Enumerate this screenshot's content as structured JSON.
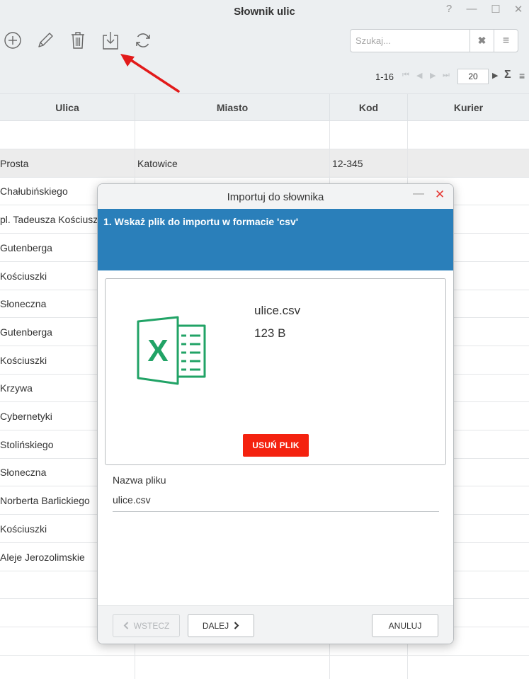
{
  "window": {
    "title": "Słownik ulic",
    "help": "?",
    "minimize": "—",
    "maximize": "☐",
    "close": "✕"
  },
  "toolbar": {
    "icons": [
      "add-icon",
      "edit-icon",
      "trash-icon",
      "import-icon",
      "refresh-icon"
    ]
  },
  "search": {
    "placeholder": "Szukaj...",
    "value": "",
    "clear": "✖",
    "menu": "≡"
  },
  "pager": {
    "range": "1-16",
    "page_size": "20",
    "first": "⏮",
    "prev": "◀",
    "next_disabled": "▶",
    "last": "⏭",
    "next": "▶",
    "sum": "Σ",
    "menu": "≡"
  },
  "grid": {
    "columns": [
      "Ulica",
      "Miasto",
      "Kod",
      "Kurier"
    ],
    "rows": [
      {
        "ulica": "",
        "miasto": "",
        "kod": ""
      },
      {
        "ulica": "Prosta",
        "miasto": "Katowice",
        "kod": "12-345"
      },
      {
        "ulica": "Chałubińskiego",
        "miasto": "",
        "kod": ""
      },
      {
        "ulica": "pl. Tadeusza Kościuszki",
        "miasto": "",
        "kod": ""
      },
      {
        "ulica": "Gutenberga",
        "miasto": "",
        "kod": ""
      },
      {
        "ulica": "Kościuszki",
        "miasto": "",
        "kod": ""
      },
      {
        "ulica": "Słoneczna",
        "miasto": "",
        "kod": ""
      },
      {
        "ulica": "Gutenberga",
        "miasto": "",
        "kod": ""
      },
      {
        "ulica": "Kościuszki",
        "miasto": "",
        "kod": ""
      },
      {
        "ulica": "Krzywa",
        "miasto": "",
        "kod": ""
      },
      {
        "ulica": "Cybernetyki",
        "miasto": "",
        "kod": ""
      },
      {
        "ulica": "Stolińskiego",
        "miasto": "",
        "kod": ""
      },
      {
        "ulica": "Słoneczna",
        "miasto": "",
        "kod": ""
      },
      {
        "ulica": "Norberta Barlickiego",
        "miasto": "",
        "kod": ""
      },
      {
        "ulica": "Kościuszki",
        "miasto": "",
        "kod": ""
      },
      {
        "ulica": "Aleje Jerozolimskie",
        "miasto": "",
        "kod": ""
      },
      {
        "ulica": "",
        "miasto": "",
        "kod": ""
      },
      {
        "ulica": "",
        "miasto": "",
        "kod": ""
      },
      {
        "ulica": "",
        "miasto": "",
        "kod": ""
      },
      {
        "ulica": "",
        "miasto": "",
        "kod": ""
      }
    ]
  },
  "dialog": {
    "title": "Importuj do słownika",
    "minimize": "—",
    "close": "✕",
    "step": "1. Wskaż plik do importu w formacie 'csv'",
    "file": {
      "name": "ulice.csv",
      "size": "123 B",
      "icon": "excel-file-icon",
      "remove_label": "USUŃ PLIK"
    },
    "filename_label": "Nazwa pliku",
    "filename_value": "ulice.csv",
    "back_label": "WSTECZ",
    "next_label": "DALEJ",
    "cancel_label": "ANULUJ"
  },
  "colors": {
    "header_bg": "#eceff1",
    "step_bg": "#2a7fba",
    "remove_button": "#f4220f",
    "close_icon": "#e53935",
    "excel_green": "#21a366",
    "annotation_arrow": "#e21a1a"
  }
}
